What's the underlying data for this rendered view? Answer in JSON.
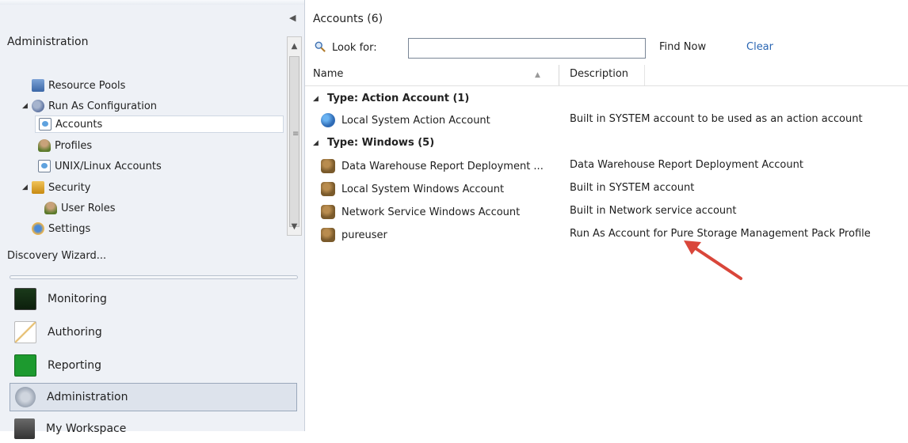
{
  "left": {
    "title": "Administration",
    "tree": [
      {
        "label": "Resource Pools",
        "icon": "resource-pools-icon"
      },
      {
        "label": "Run As Configuration",
        "icon": "run-as-configuration-icon"
      },
      {
        "label": "Accounts",
        "icon": "accounts-icon",
        "selected": true
      },
      {
        "label": "Profiles",
        "icon": "profiles-icon"
      },
      {
        "label": "UNIX/Linux Accounts",
        "icon": "unix-linux-accounts-icon"
      },
      {
        "label": "Security",
        "icon": "security-lock-icon"
      },
      {
        "label": "User Roles",
        "icon": "user-roles-icon"
      },
      {
        "label": "Settings",
        "icon": "settings-icon"
      }
    ],
    "discovery_link": "Discovery Wizard...",
    "wunderbar": [
      {
        "label": "Monitoring"
      },
      {
        "label": "Authoring"
      },
      {
        "label": "Reporting"
      },
      {
        "label": "Administration",
        "active": true
      },
      {
        "label": "My Workspace"
      }
    ]
  },
  "main": {
    "title": "Accounts (6)",
    "search": {
      "label": "Look for:",
      "value": "",
      "find_now": "Find Now",
      "clear": "Clear"
    },
    "columns": {
      "name": "Name",
      "description": "Description"
    },
    "groups": [
      {
        "label": "Type: Action Account (1)",
        "rows": [
          {
            "name": "Local System Action Account",
            "description": "Built in SYSTEM account to be used as an action account"
          }
        ]
      },
      {
        "label": "Type: Windows (5)",
        "rows": [
          {
            "name": "Data Warehouse Report Deployment ...",
            "description": "Data Warehouse Report Deployment Account"
          },
          {
            "name": "Local System Windows Account",
            "description": "Built in SYSTEM account"
          },
          {
            "name": "Network Service Windows Account",
            "description": "Built in Network service account"
          },
          {
            "name": "pureuser",
            "description": "Run As Account for Pure Storage Management Pack Profile"
          }
        ]
      }
    ],
    "annotation_color": "#d9463a"
  }
}
